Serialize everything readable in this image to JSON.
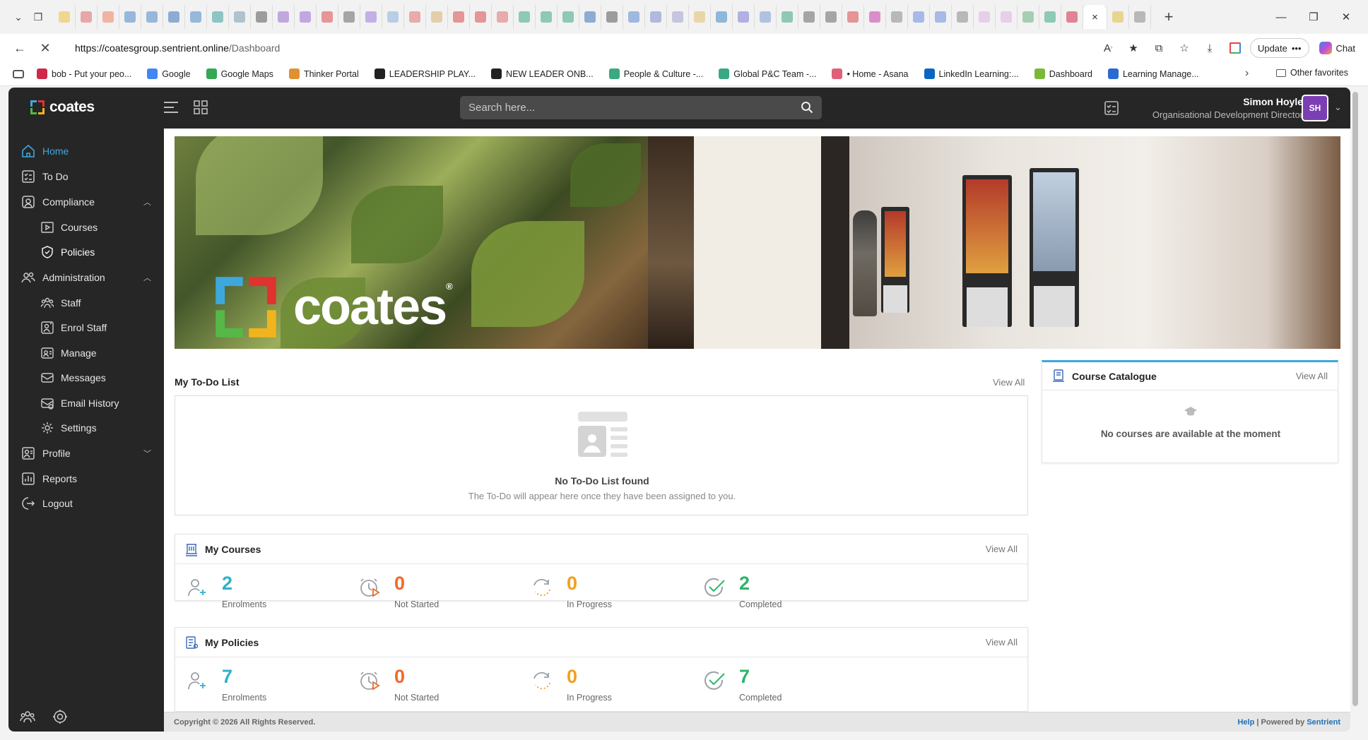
{
  "browser": {
    "tab_favicon_colors": [
      "#f0c040",
      "#e06a6a",
      "#f08060",
      "#4a88c8",
      "#4a88c8",
      "#3a73b8",
      "#4a88c8",
      "#3aa0a0",
      "#7a9ab0",
      "#555555",
      "#9a6ad0",
      "#9a6ad0",
      "#e04848",
      "#666666",
      "#9a7ad8",
      "#88b0d8",
      "#e07070",
      "#d8b070",
      "#d84848",
      "#d84848",
      "#e07070",
      "#3aa880",
      "#3aa880",
      "#3aa880",
      "#3a73b8",
      "#555555",
      "#5a8ad0",
      "#7a8ad0",
      "#a0a0d0",
      "#e0c070",
      "#3a88c8",
      "#7a7ad8",
      "#7a9ad8",
      "#3aa880",
      "#666666",
      "#666666",
      "#d84848",
      "#c83aa8",
      "#888888",
      "#6a8ae0",
      "#6a8ae0",
      "#888888",
      "#e0b0e0",
      "#e0b0e0",
      "#6ab080",
      "#3aa880",
      "#d02848",
      "#e0c040",
      "#888888"
    ],
    "active_tab_close": "×",
    "url_domain": "https://coatesgroup.sentrient.online",
    "url_path": "/Dashboard",
    "update_label": "Update",
    "chat_label": "Chat",
    "favorites": [
      {
        "label": "bob - Put your peo...",
        "color": "#d02848"
      },
      {
        "label": "Google",
        "color": "#4285f4"
      },
      {
        "label": "Google Maps",
        "color": "#34a853"
      },
      {
        "label": "Thinker Portal",
        "color": "#e09030"
      },
      {
        "label": "LEADERSHIP PLAY...",
        "color": "#222222"
      },
      {
        "label": "NEW LEADER ONB...",
        "color": "#222222"
      },
      {
        "label": "People & Culture -...",
        "color": "#3aa880"
      },
      {
        "label": "Global P&C Team -...",
        "color": "#3aa880"
      },
      {
        "label": "• Home - Asana",
        "color": "#e0607a"
      },
      {
        "label": "LinkedIn Learning:...",
        "color": "#0a66c2"
      },
      {
        "label": "Dashboard",
        "color": "#7ab83a"
      },
      {
        "label": "Learning Manage...",
        "color": "#2a6ad0"
      }
    ],
    "other_favorites": "Other favorites"
  },
  "header": {
    "logo_text": "coates",
    "search_placeholder": "Search here...",
    "user_name": "Simon Hoyle",
    "user_role": "Organisational Development Director",
    "avatar_initials": "SH"
  },
  "sidebar": {
    "items": [
      {
        "label": "Home"
      },
      {
        "label": "To Do"
      },
      {
        "label": "Compliance"
      },
      {
        "label": "Courses"
      },
      {
        "label": "Policies"
      },
      {
        "label": "Administration"
      },
      {
        "label": "Staff"
      },
      {
        "label": "Enrol Staff"
      },
      {
        "label": "Manage"
      },
      {
        "label": "Messages"
      },
      {
        "label": "Email History"
      },
      {
        "label": "Settings"
      },
      {
        "label": "Profile"
      },
      {
        "label": "Reports"
      },
      {
        "label": "Logout"
      }
    ],
    "accent": "#3ea8dd"
  },
  "banner": {
    "logo_word": "coates",
    "reg": "®"
  },
  "todo": {
    "title": "My To-Do List",
    "view_all": "View All",
    "empty_title": "No To-Do List found",
    "empty_sub": "The To-Do will appear here once they have been assigned to you."
  },
  "catalogue": {
    "title": "Course Catalogue",
    "view_all": "View All",
    "empty": "No courses are available at the moment"
  },
  "my_courses": {
    "title": "My Courses",
    "view_all": "View All",
    "stats": [
      {
        "value": "2",
        "label": "Enrolments",
        "color": "#2eb2c8"
      },
      {
        "value": "0",
        "label": "Not Started",
        "color": "#ef6a2a"
      },
      {
        "value": "0",
        "label": "In Progress",
        "color": "#f0a020"
      },
      {
        "value": "2",
        "label": "Completed",
        "color": "#2cb56a"
      }
    ]
  },
  "my_policies": {
    "title": "My Policies",
    "view_all": "View All",
    "stats": [
      {
        "value": "7",
        "label": "Enrolments",
        "color": "#2eb2c8"
      },
      {
        "value": "0",
        "label": "Not Started",
        "color": "#ef6a2a"
      },
      {
        "value": "0",
        "label": "In Progress",
        "color": "#f0a020"
      },
      {
        "value": "7",
        "label": "Completed",
        "color": "#2cb56a"
      }
    ]
  },
  "footer": {
    "copyright": "Copyright © 2026 All Rights Reserved.",
    "help": "Help",
    "powered_prefix": "| Powered by",
    "powered_by": "Sentrient"
  }
}
